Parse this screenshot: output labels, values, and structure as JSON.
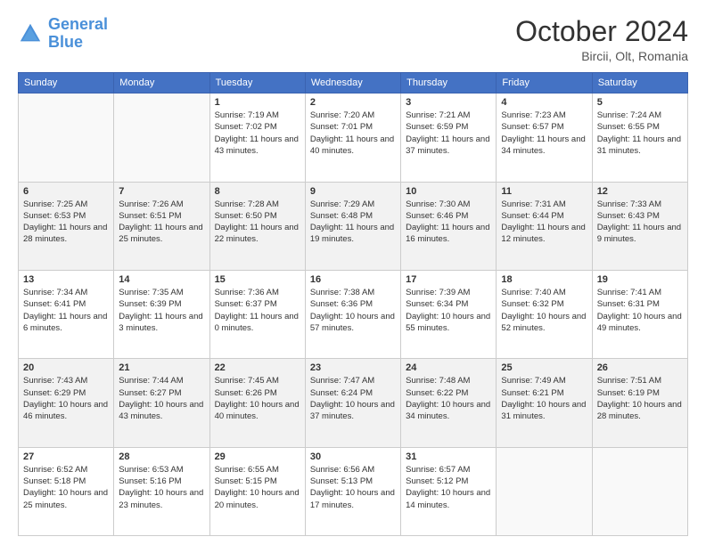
{
  "header": {
    "logo_line1": "General",
    "logo_line2": "Blue",
    "month": "October 2024",
    "location": "Bircii, Olt, Romania"
  },
  "weekdays": [
    "Sunday",
    "Monday",
    "Tuesday",
    "Wednesday",
    "Thursday",
    "Friday",
    "Saturday"
  ],
  "weeks": [
    [
      null,
      null,
      {
        "day": 1,
        "sunrise": "7:19 AM",
        "sunset": "7:02 PM",
        "daylight": "11 hours and 43 minutes."
      },
      {
        "day": 2,
        "sunrise": "7:20 AM",
        "sunset": "7:01 PM",
        "daylight": "11 hours and 40 minutes."
      },
      {
        "day": 3,
        "sunrise": "7:21 AM",
        "sunset": "6:59 PM",
        "daylight": "11 hours and 37 minutes."
      },
      {
        "day": 4,
        "sunrise": "7:23 AM",
        "sunset": "6:57 PM",
        "daylight": "11 hours and 34 minutes."
      },
      {
        "day": 5,
        "sunrise": "7:24 AM",
        "sunset": "6:55 PM",
        "daylight": "11 hours and 31 minutes."
      }
    ],
    [
      {
        "day": 6,
        "sunrise": "7:25 AM",
        "sunset": "6:53 PM",
        "daylight": "11 hours and 28 minutes."
      },
      {
        "day": 7,
        "sunrise": "7:26 AM",
        "sunset": "6:51 PM",
        "daylight": "11 hours and 25 minutes."
      },
      {
        "day": 8,
        "sunrise": "7:28 AM",
        "sunset": "6:50 PM",
        "daylight": "11 hours and 22 minutes."
      },
      {
        "day": 9,
        "sunrise": "7:29 AM",
        "sunset": "6:48 PM",
        "daylight": "11 hours and 19 minutes."
      },
      {
        "day": 10,
        "sunrise": "7:30 AM",
        "sunset": "6:46 PM",
        "daylight": "11 hours and 16 minutes."
      },
      {
        "day": 11,
        "sunrise": "7:31 AM",
        "sunset": "6:44 PM",
        "daylight": "11 hours and 12 minutes."
      },
      {
        "day": 12,
        "sunrise": "7:33 AM",
        "sunset": "6:43 PM",
        "daylight": "11 hours and 9 minutes."
      }
    ],
    [
      {
        "day": 13,
        "sunrise": "7:34 AM",
        "sunset": "6:41 PM",
        "daylight": "11 hours and 6 minutes."
      },
      {
        "day": 14,
        "sunrise": "7:35 AM",
        "sunset": "6:39 PM",
        "daylight": "11 hours and 3 minutes."
      },
      {
        "day": 15,
        "sunrise": "7:36 AM",
        "sunset": "6:37 PM",
        "daylight": "11 hours and 0 minutes."
      },
      {
        "day": 16,
        "sunrise": "7:38 AM",
        "sunset": "6:36 PM",
        "daylight": "10 hours and 57 minutes."
      },
      {
        "day": 17,
        "sunrise": "7:39 AM",
        "sunset": "6:34 PM",
        "daylight": "10 hours and 55 minutes."
      },
      {
        "day": 18,
        "sunrise": "7:40 AM",
        "sunset": "6:32 PM",
        "daylight": "10 hours and 52 minutes."
      },
      {
        "day": 19,
        "sunrise": "7:41 AM",
        "sunset": "6:31 PM",
        "daylight": "10 hours and 49 minutes."
      }
    ],
    [
      {
        "day": 20,
        "sunrise": "7:43 AM",
        "sunset": "6:29 PM",
        "daylight": "10 hours and 46 minutes."
      },
      {
        "day": 21,
        "sunrise": "7:44 AM",
        "sunset": "6:27 PM",
        "daylight": "10 hours and 43 minutes."
      },
      {
        "day": 22,
        "sunrise": "7:45 AM",
        "sunset": "6:26 PM",
        "daylight": "10 hours and 40 minutes."
      },
      {
        "day": 23,
        "sunrise": "7:47 AM",
        "sunset": "6:24 PM",
        "daylight": "10 hours and 37 minutes."
      },
      {
        "day": 24,
        "sunrise": "7:48 AM",
        "sunset": "6:22 PM",
        "daylight": "10 hours and 34 minutes."
      },
      {
        "day": 25,
        "sunrise": "7:49 AM",
        "sunset": "6:21 PM",
        "daylight": "10 hours and 31 minutes."
      },
      {
        "day": 26,
        "sunrise": "7:51 AM",
        "sunset": "6:19 PM",
        "daylight": "10 hours and 28 minutes."
      }
    ],
    [
      {
        "day": 27,
        "sunrise": "6:52 AM",
        "sunset": "5:18 PM",
        "daylight": "10 hours and 25 minutes."
      },
      {
        "day": 28,
        "sunrise": "6:53 AM",
        "sunset": "5:16 PM",
        "daylight": "10 hours and 23 minutes."
      },
      {
        "day": 29,
        "sunrise": "6:55 AM",
        "sunset": "5:15 PM",
        "daylight": "10 hours and 20 minutes."
      },
      {
        "day": 30,
        "sunrise": "6:56 AM",
        "sunset": "5:13 PM",
        "daylight": "10 hours and 17 minutes."
      },
      {
        "day": 31,
        "sunrise": "6:57 AM",
        "sunset": "5:12 PM",
        "daylight": "10 hours and 14 minutes."
      },
      null,
      null
    ]
  ]
}
